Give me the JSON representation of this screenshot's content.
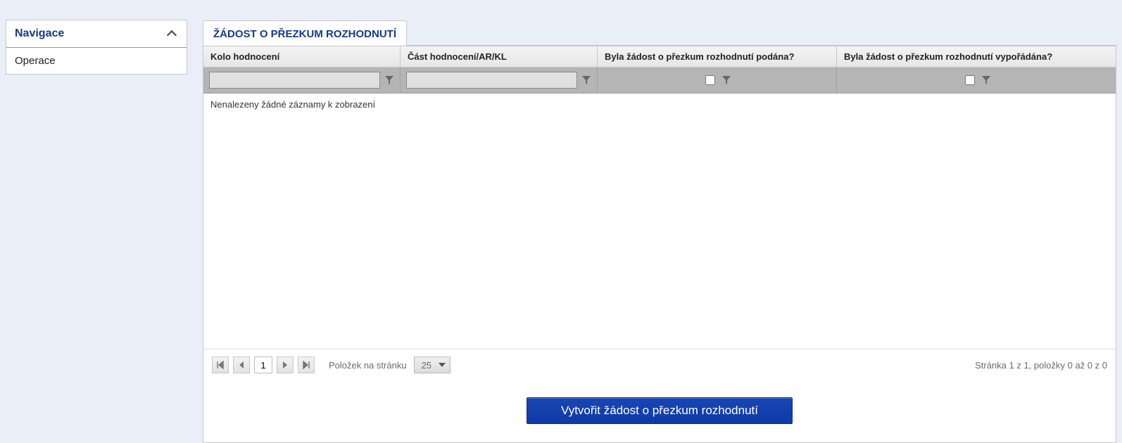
{
  "sidebar": {
    "nav_title": "Navigace",
    "items": [
      {
        "label": "Operace"
      }
    ]
  },
  "tab": {
    "title": "ŽÁDOST O PŘEZKUM ROZHODNUTÍ"
  },
  "grid": {
    "columns": {
      "c1": "Kolo hodnocení",
      "c2": "Část hodnocení/AR/KL",
      "c3": "Byla žádost o přezkum rozhodnutí podána?",
      "c4": "Byla žádost o přezkum rozhodnutí vypořádána?"
    },
    "empty_message": "Nenalezeny žádné záznamy k zobrazení",
    "rows": []
  },
  "pager": {
    "page": "1",
    "page_size_label": "Položek na stránku",
    "page_size": "25",
    "status_text": "Stránka 1 z 1, položky 0 až 0 z 0"
  },
  "actions": {
    "create_request": "Vytvořit žádost o přezkum rozhodnutí"
  }
}
